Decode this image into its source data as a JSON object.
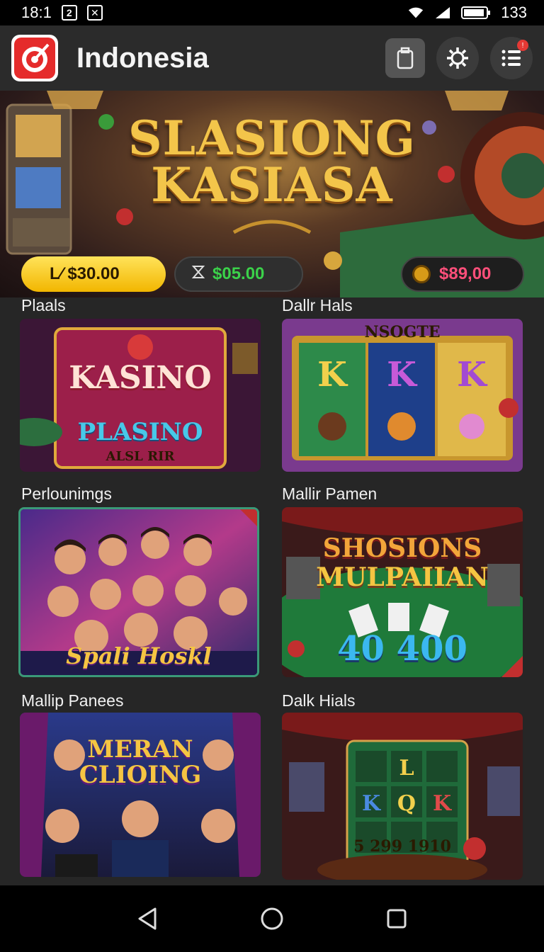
{
  "status_bar": {
    "time": "18:1",
    "right_text": "133"
  },
  "app_bar": {
    "title": "Indonesia"
  },
  "hero": {
    "title_line1": "SLASIONG",
    "title_line2": "KASIASA",
    "balances": [
      {
        "label": "L⁄ $30.00"
      },
      {
        "label": "$05.00"
      },
      {
        "label": "$89,00"
      }
    ]
  },
  "sections": [
    {
      "label": "Plaals",
      "card_title": "KASINO",
      "card_subtitle": "PLASINO",
      "card_caption": "ALSL RIR"
    },
    {
      "label": "Dallr Hals",
      "card_title": "NSOGTE"
    },
    {
      "label": "Perlounimgs",
      "card_title": "Spali Hoskl"
    },
    {
      "label": "Mallir Pamen",
      "card_title": "SHOSIONS",
      "card_subtitle": "MULPAIIAN",
      "card_caption": "40 400"
    },
    {
      "label": "Mallip Panees",
      "card_title": "MERAN",
      "card_subtitle": "CLIOING"
    },
    {
      "label": "Dalk Hials",
      "card_caption": "5 299 1910"
    }
  ]
}
